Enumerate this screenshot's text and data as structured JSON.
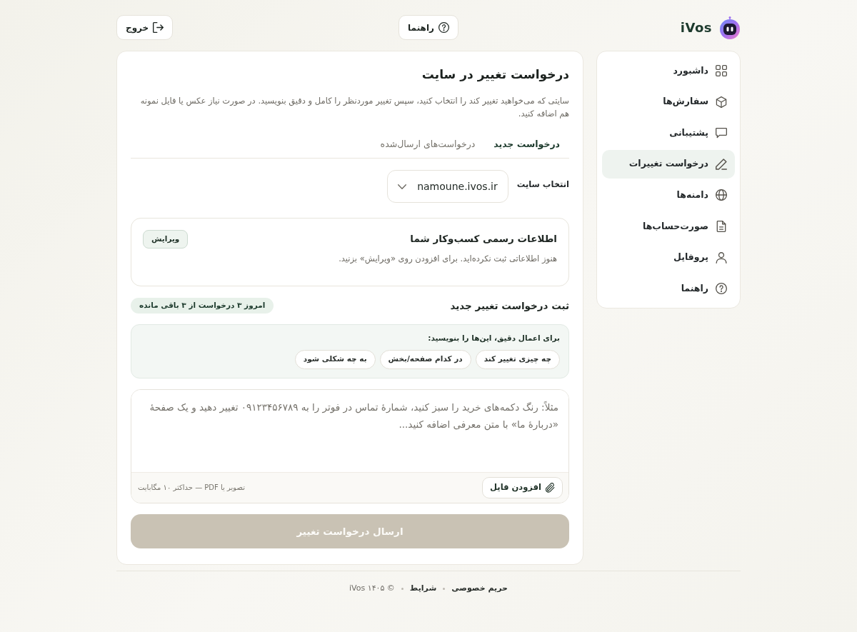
{
  "header": {
    "logo": {
      "text": "iVos"
    },
    "help_button": {
      "label": "راهنما"
    },
    "logout_button": {
      "label": "خروج"
    }
  },
  "sidebar": {
    "items": [
      {
        "label": "داشبورد",
        "selected": false
      },
      {
        "label": "سفارش‌ها",
        "selected": false
      },
      {
        "label": "پشتیبانی",
        "selected": false
      },
      {
        "label": "درخواست تغییرات",
        "selected": true
      },
      {
        "label": "دامنه‌ها",
        "selected": false
      },
      {
        "label": "صورت‌حساب‌ها",
        "selected": false
      },
      {
        "label": "پروفایل",
        "selected": false
      },
      {
        "label": "راهنما",
        "selected": false
      }
    ]
  },
  "main": {
    "title": "درخواست تغییر در سایت",
    "description": "سایتی که می‌خواهید تغییر کند را انتخاب کنید، سپس تغییر موردنظر را کامل و دقیق بنویسید. در صورت نیاز عکس یا فایل نمونه هم اضافه کنید.",
    "tabs": [
      {
        "label": "درخواست جدید",
        "selected": true
      },
      {
        "label": "درخواست‌های ارسال‌شده",
        "selected": false
      }
    ],
    "site_select": {
      "label": "انتخاب سایت",
      "value": "namoune.ivos.ir"
    },
    "business_info": {
      "title": "اطلاعات رسمی کسب‌وکار شما",
      "text": "هنوز اطلاعاتی ثبت نکرده‌اید. برای افزودن روی «ویرایش» بزنید.",
      "edit_button": "ویرایش"
    },
    "new_request": {
      "title": "ثبت درخواست تغییر جدید",
      "quota_badge": "امروز ۳ درخواست از ۳ باقی مانده",
      "hint": {
        "title": "برای اعمال دقیق، این‌ها را بنویسید:",
        "chips": [
          "چه چیزی تغییر کند",
          "در کدام صفحه/بخش",
          "به چه شکلی شود"
        ]
      },
      "message": {
        "placeholder": "مثلاً: رنگ دکمه‌های خرید را سبز کنید، شمارهٔ تماس در فوتر را به ۰۹۱۲۳۴۵۶۷۸۹ تغییر دهید و یک صفحهٔ «دربارهٔ ما» با متن معرفی اضافه کنید..."
      },
      "attach_button": "افزودن فایل",
      "attach_note": "تصویر یا PDF — حداکثر ۱۰ مگابایت",
      "submit_button": {
        "label": "ارسال درخواست تغییر",
        "disabled": true
      }
    }
  },
  "footer": {
    "links": [
      "حریم خصوصی",
      "شرایط"
    ],
    "copyright": "© ۱۴۰۵ iVos"
  }
}
